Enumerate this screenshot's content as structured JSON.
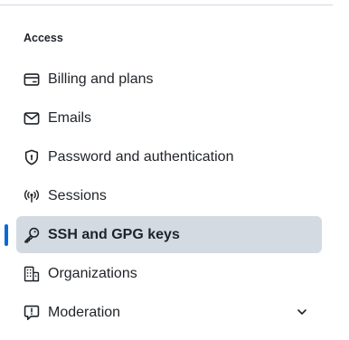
{
  "section": {
    "heading": "Access"
  },
  "nav": {
    "items": [
      {
        "label": "Billing and plans",
        "icon": "credit-card-icon"
      },
      {
        "label": "Emails",
        "icon": "mail-icon"
      },
      {
        "label": "Password and authentication",
        "icon": "shield-lock-icon"
      },
      {
        "label": "Sessions",
        "icon": "broadcast-icon"
      },
      {
        "label": "SSH and GPG keys",
        "icon": "key-icon",
        "active": true
      },
      {
        "label": "Organizations",
        "icon": "organization-icon"
      },
      {
        "label": "Moderation",
        "icon": "report-icon",
        "expandable": true
      }
    ]
  },
  "colors": {
    "accent": "#0969da",
    "active_bg": "#d3dae2",
    "text": "#1f2328",
    "divider": "#d1d9e0"
  }
}
